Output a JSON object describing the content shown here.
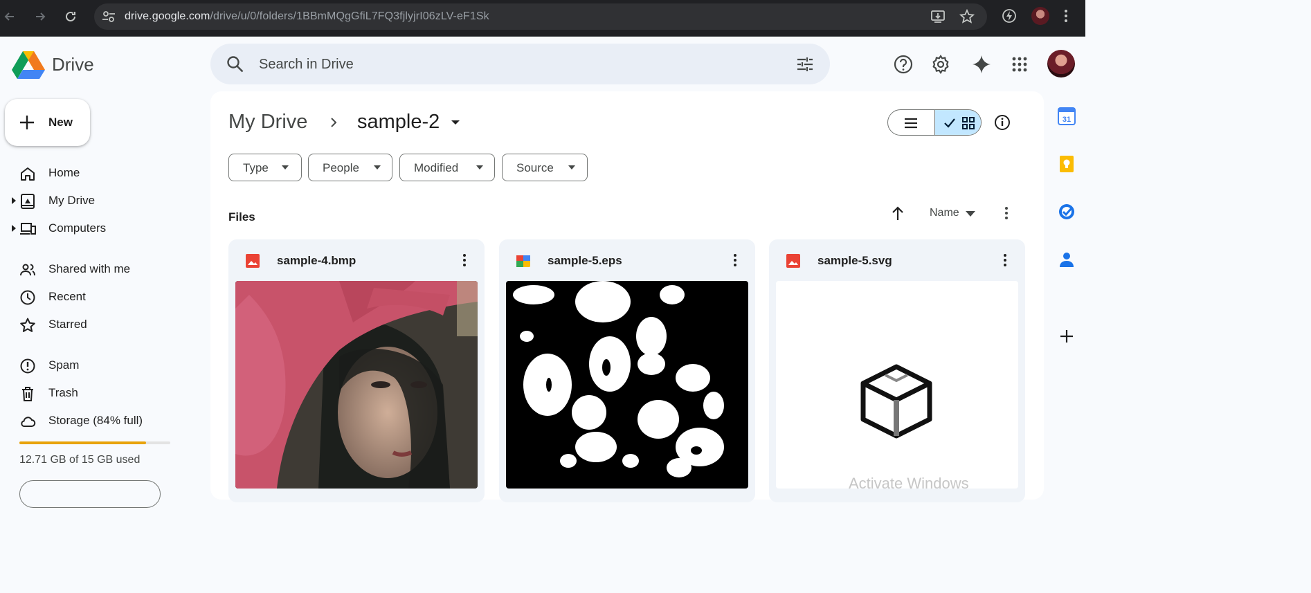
{
  "browser": {
    "url_host": "drive.google.com",
    "url_path": "/drive/u/0/folders/1BBmMQgGfiL7FQ3fjlyjrI06zLV-eF1Sk"
  },
  "app": {
    "name": "Drive",
    "search_placeholder": "Search in Drive"
  },
  "sidebar": {
    "new_label": "New",
    "items": [
      {
        "label": "Home",
        "icon": "home-icon"
      },
      {
        "label": "My Drive",
        "icon": "my-drive-icon"
      },
      {
        "label": "Computers",
        "icon": "computers-icon"
      },
      {
        "label": "Shared with me",
        "icon": "shared-icon"
      },
      {
        "label": "Recent",
        "icon": "clock-icon"
      },
      {
        "label": "Starred",
        "icon": "star-icon"
      },
      {
        "label": "Spam",
        "icon": "spam-icon"
      },
      {
        "label": "Trash",
        "icon": "trash-icon"
      },
      {
        "label": "Storage (84% full)",
        "icon": "cloud-icon"
      }
    ],
    "storage": {
      "used_fraction": 0.84,
      "text": "12.71 GB of 15 GB used"
    }
  },
  "breadcrumb": {
    "root": "My Drive",
    "current": "sample-2"
  },
  "filters": [
    "Type",
    "People",
    "Modified",
    "Source"
  ],
  "files_section": {
    "label": "Files",
    "sort_label": "Name"
  },
  "files": [
    {
      "name": "sample-4.bmp",
      "icon": "image-file-icon"
    },
    {
      "name": "sample-5.eps",
      "icon": "eps-file-icon"
    },
    {
      "name": "sample-5.svg",
      "icon": "image-file-icon"
    }
  ],
  "watermark": "Activate Windows",
  "colors": {
    "accent": "#0b57d0",
    "selected": "#c2e7ff",
    "storage": "#e8a30c",
    "image_icon": "#ea4335"
  }
}
